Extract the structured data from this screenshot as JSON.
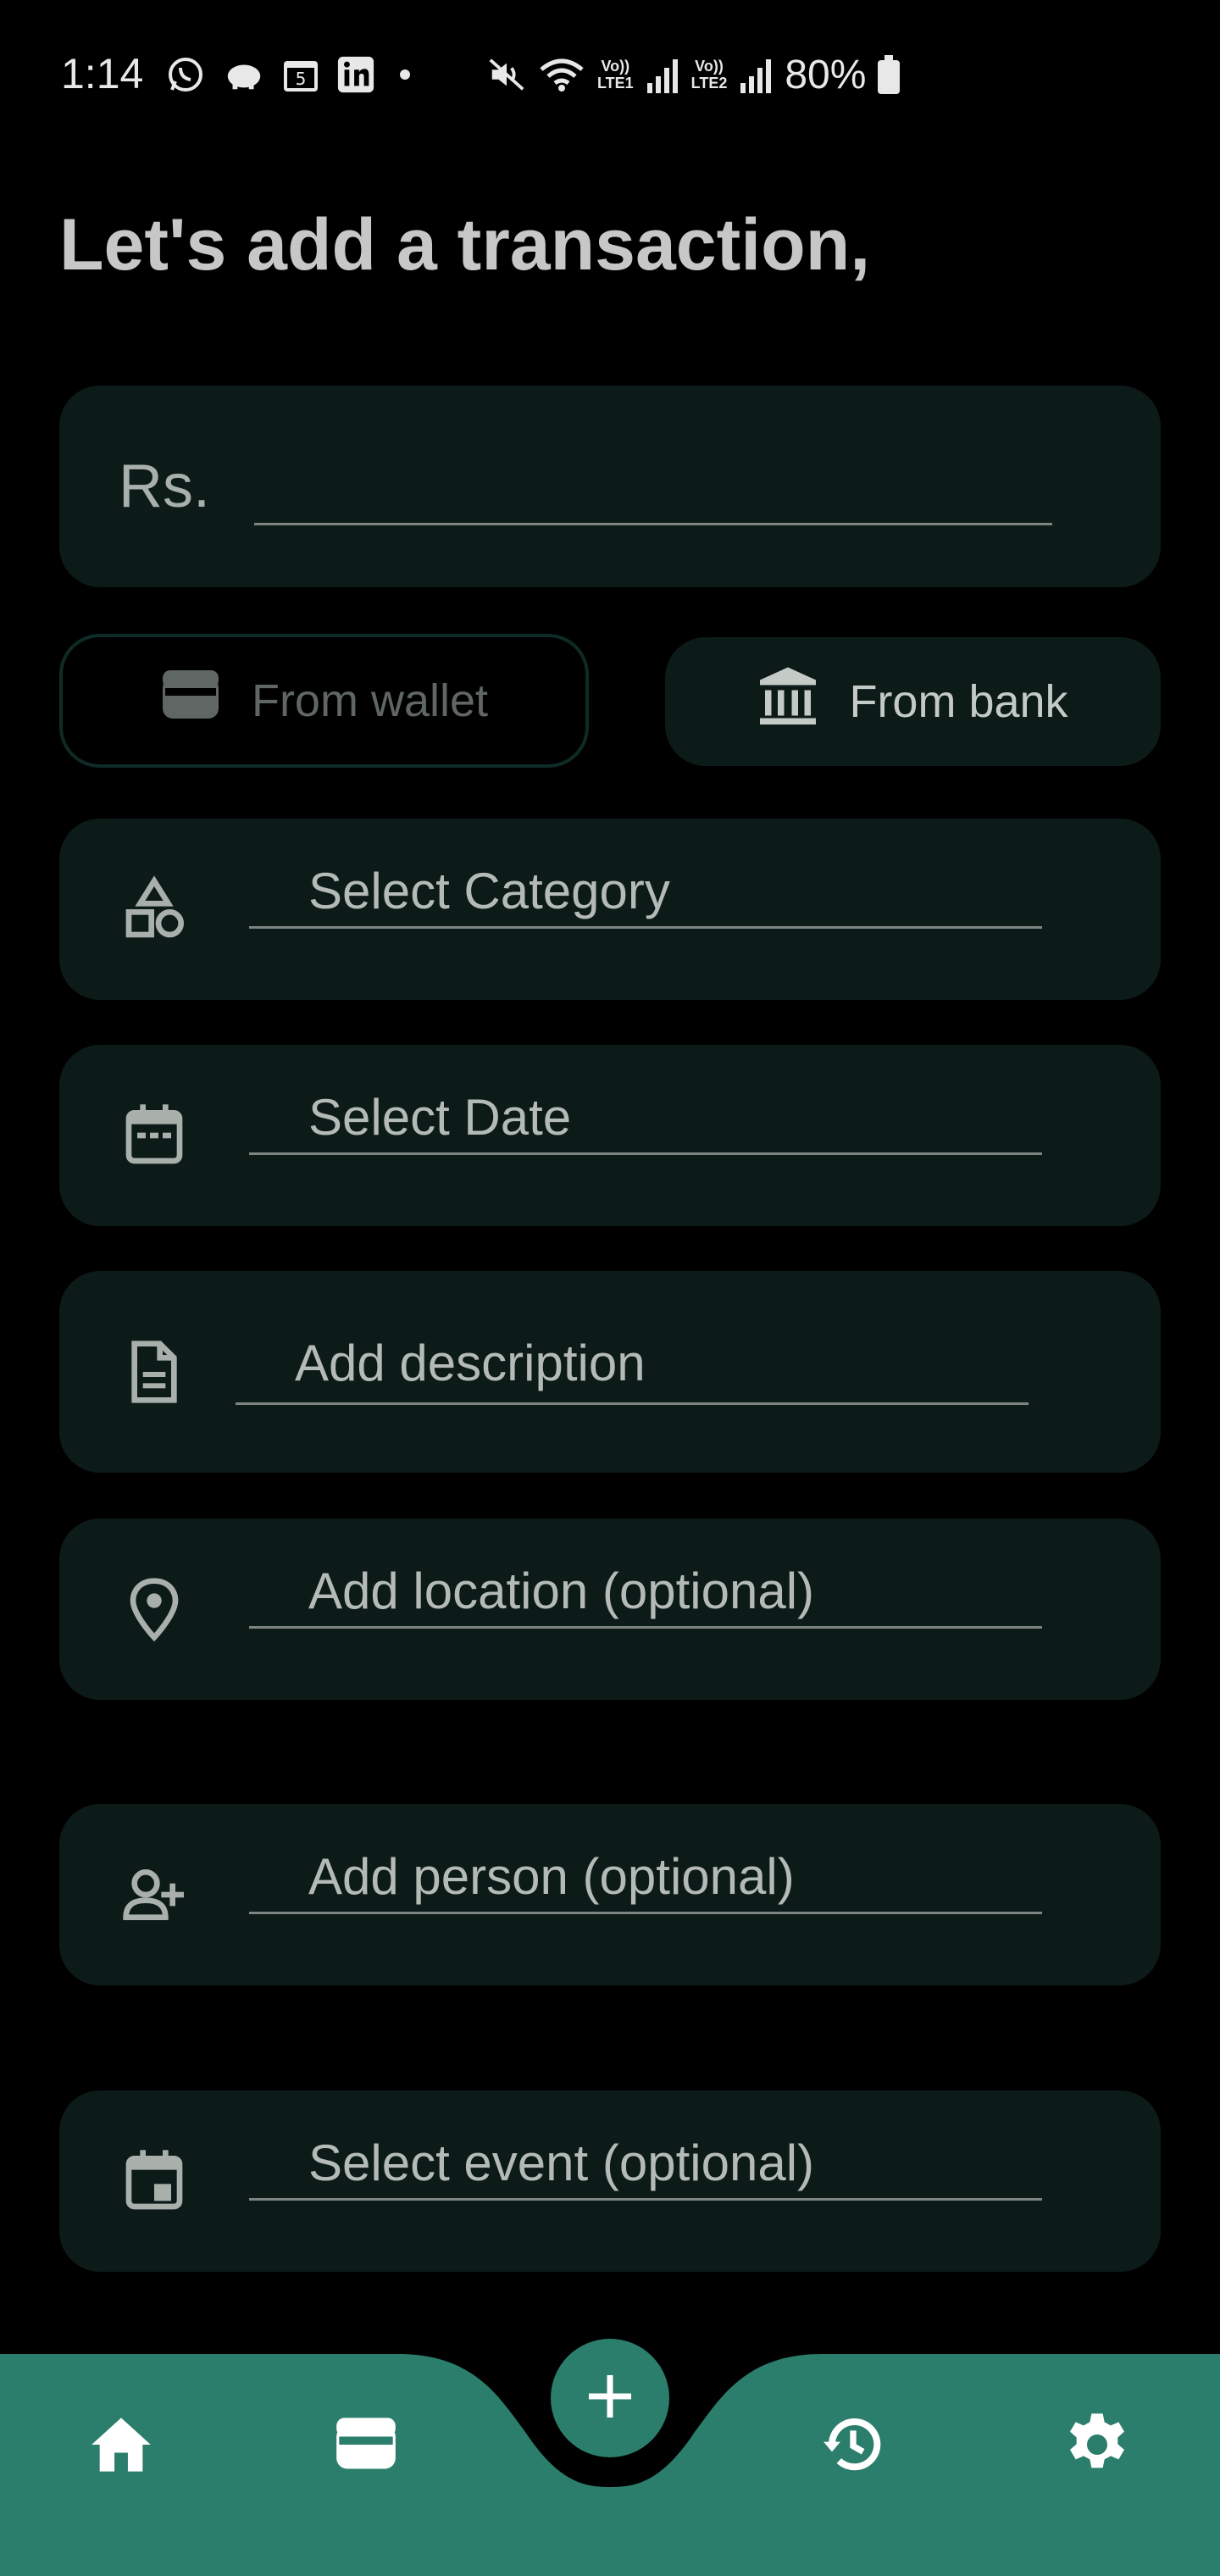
{
  "status_bar": {
    "time": "1:14",
    "sim1_label_top": "Vo))",
    "sim1_label_bottom": "LTE1",
    "sim2_label_top": "Vo))",
    "sim2_label_bottom": "LTE2",
    "battery": "80%",
    "calendar_day": "5",
    "icons_left": [
      "whatsapp-icon",
      "piggy-bank-icon",
      "calendar-icon",
      "linkedin-icon",
      "dot-icon"
    ],
    "icons_right": [
      "mute-icon",
      "wifi-icon",
      "signal-icon",
      "signal-icon",
      "battery-icon"
    ]
  },
  "title": "Let's add a transaction,",
  "amount": {
    "currency": "Rs.",
    "value": ""
  },
  "source": {
    "wallet_label": "From wallet",
    "bank_label": "From bank",
    "selected": "bank"
  },
  "fields": {
    "category": {
      "placeholder": "Select Category",
      "icon": "category-shapes-icon"
    },
    "date": {
      "placeholder": "Select Date",
      "icon": "calendar-icon"
    },
    "description": {
      "placeholder": "Add description",
      "icon": "document-icon"
    },
    "location": {
      "placeholder": "Add location (optional)",
      "icon": "location-pin-icon"
    },
    "person": {
      "placeholder": "Add person (optional)",
      "icon": "add-person-icon"
    },
    "event": {
      "placeholder": "Select event (optional)",
      "icon": "event-icon"
    }
  },
  "nav": {
    "items": [
      "home-icon",
      "wallet-icon",
      "add-icon",
      "history-icon",
      "settings-icon"
    ],
    "active": "add"
  },
  "colors": {
    "background": "#000000",
    "card": "#0c1a18",
    "accent": "#2b7d6c",
    "text": "#c4cac6"
  }
}
